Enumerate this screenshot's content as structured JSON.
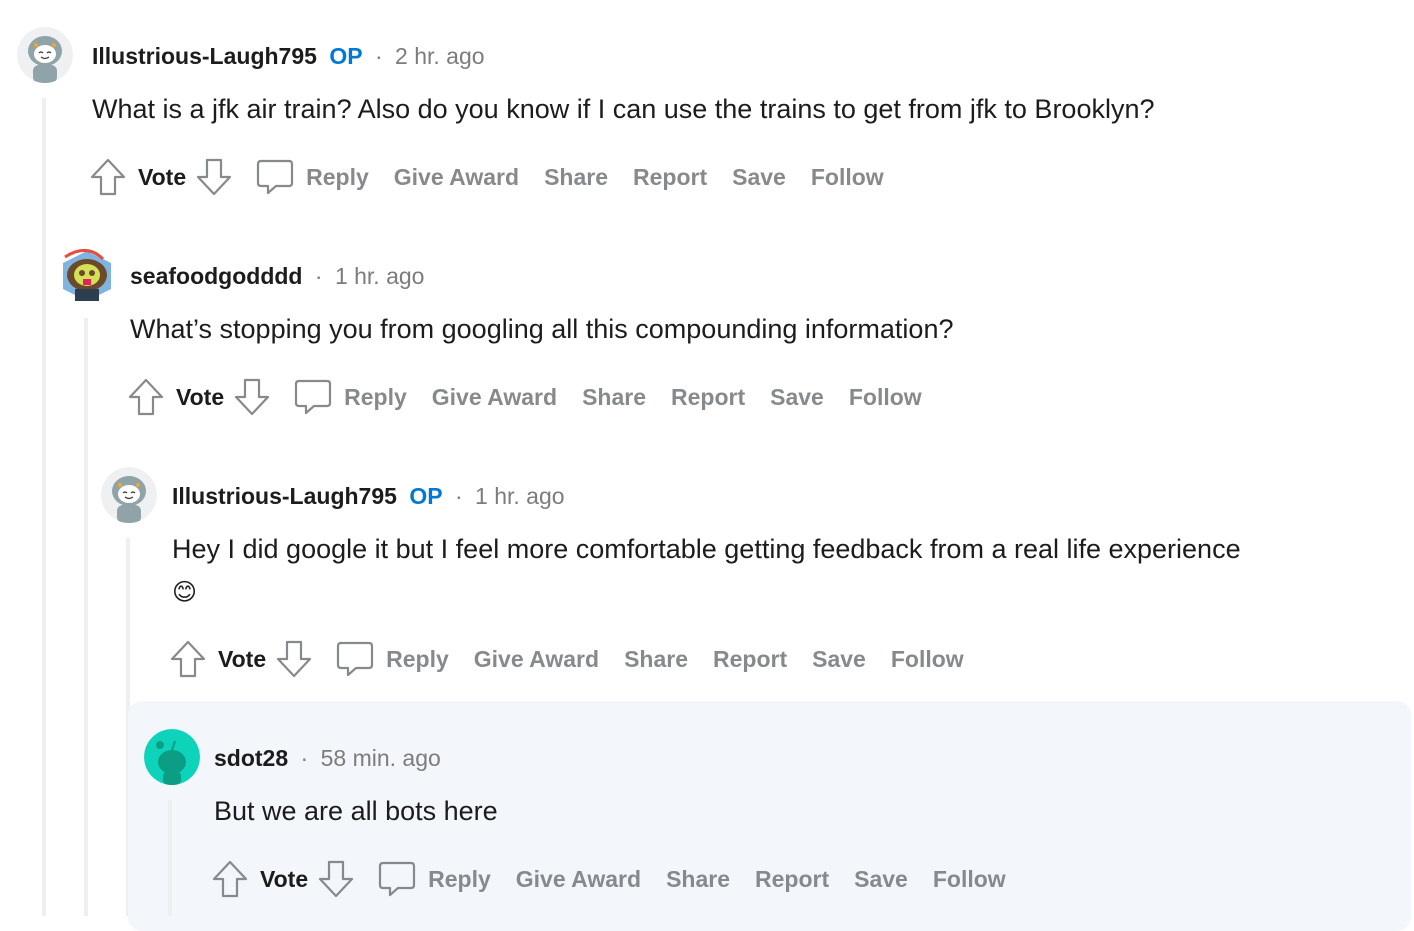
{
  "comments": [
    {
      "author": "Illustrious-Laugh795",
      "op_badge": "OP",
      "separator": "·",
      "time": "2 hr. ago",
      "body_lines": [
        "What is a jfk air train? Also do you know if I can use the trains to get from jfk to Brooklyn?"
      ],
      "avatar_icon": "snoo-avatar-hoodie"
    },
    {
      "author": "seafoodgodddd",
      "op_badge": "",
      "separator": "·",
      "time": "1 hr. ago",
      "body_lines": [
        "What’s stopping you from googling all this compounding information?"
      ],
      "avatar_icon": "snoo-avatar-rainbow"
    },
    {
      "author": "Illustrious-Laugh795",
      "op_badge": "OP",
      "separator": "·",
      "time": "1 hr. ago",
      "body_lines": [
        "Hey I did google it but I feel more comfortable getting feedback from a real life experience",
        "😊"
      ],
      "avatar_icon": "snoo-avatar-hoodie"
    },
    {
      "author": "sdot28",
      "op_badge": "",
      "separator": "·",
      "time": "58 min. ago",
      "body_lines": [
        "But we are all bots here"
      ],
      "avatar_icon": "snoo-avatar-default"
    }
  ],
  "actions": {
    "vote": "Vote",
    "reply": "Reply",
    "give_award": "Give Award",
    "share": "Share",
    "report": "Report",
    "save": "Save",
    "follow": "Follow"
  },
  "colors": {
    "op": "#0079d3",
    "muted": "#878a8c",
    "highlight_bg": "#f3f6fb",
    "thread_line": "#edeff1"
  }
}
